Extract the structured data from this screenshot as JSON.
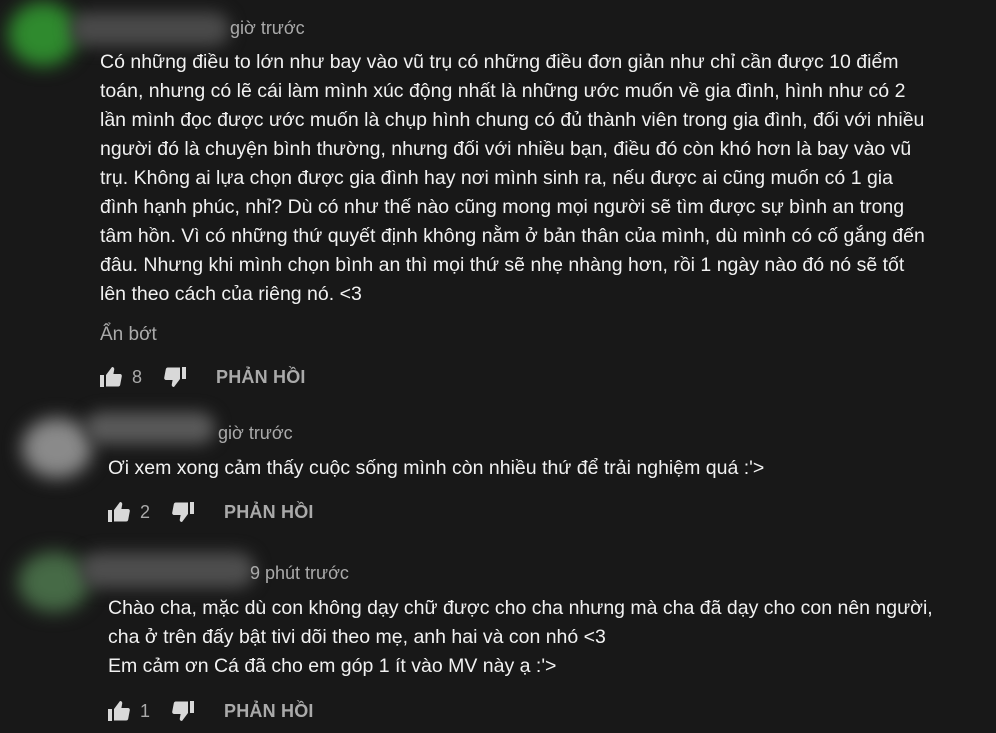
{
  "comments": [
    {
      "time": "giờ trước",
      "text": "Có những điều to lớn như bay vào vũ trụ có những điều đơn giản như chỉ cần được 10 điểm\ntoán, nhưng có lẽ cái làm mình xúc động nhất là những ước muốn về gia đình, hình như có 2\nlần mình đọc được ước muốn là chụp hình chung có đủ thành viên trong gia đình, đối với nhiều\nngười đó là chuyện bình thường, nhưng đối với nhiều bạn, điều đó còn khó hơn là bay vào vũ\ntrụ. Không ai lựa chọn được gia đình hay nơi mình sinh ra, nếu được ai cũng muốn có 1 gia\nđình hạnh phúc, nhỉ? Dù có như thế nào cũng mong mọi người sẽ tìm được sự bình an trong\ntâm hồn. Vì có những thứ quyết định không nằm ở bản thân của mình, dù mình có cố gắng đến\nđâu. Nhưng khi mình chọn bình an thì mọi thứ sẽ nhẹ nhàng hơn, rồi 1 ngày nào đó nó sẽ tốt\nlên theo cách của riêng nó. <3",
      "toggle": "Ẩn bớt",
      "likes": "8",
      "reply": "PHẢN HỒI",
      "avatar_color": "#3f9a3a"
    },
    {
      "time": "giờ trước",
      "text": "Ơi xem xong cảm thấy cuộc sống mình còn nhiều thứ để trải nghiệm quá :'>",
      "likes": "2",
      "reply": "PHẢN HỒI",
      "avatar_color": "#8a8a8a"
    },
    {
      "time": "9 phút trước",
      "text": "Chào cha, mặc dù con không dạy chữ được cho cha nhưng mà cha đã dạy cho con nên người,\ncha ở trên đấy bật tivi dõi theo mẹ, anh hai và con nhó  <3\nEm cảm ơn Cá đã cho em góp 1 ít vào MV này ạ :'>",
      "likes": "1",
      "reply": "PHẢN HỒI",
      "avatar_color": "#4a6e4a"
    }
  ],
  "icons": {
    "like": "thumbs-up-icon",
    "dislike": "thumbs-down-icon"
  }
}
